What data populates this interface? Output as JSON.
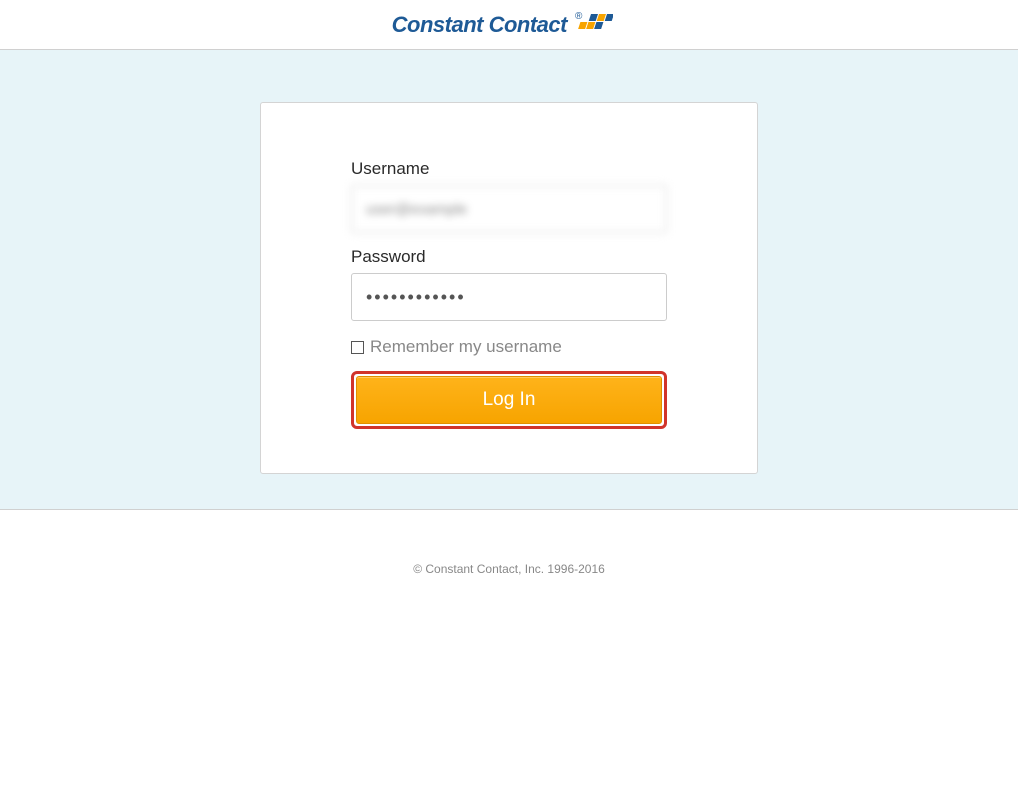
{
  "header": {
    "logo_text": "Constant Contact"
  },
  "login": {
    "username_label": "Username",
    "username_value": "user@example",
    "password_label": "Password",
    "password_value": "••••••••••••",
    "remember_label": "Remember my username",
    "login_button": "Log In"
  },
  "footer": {
    "copyright": "© Constant Contact, Inc. 1996-2016"
  }
}
